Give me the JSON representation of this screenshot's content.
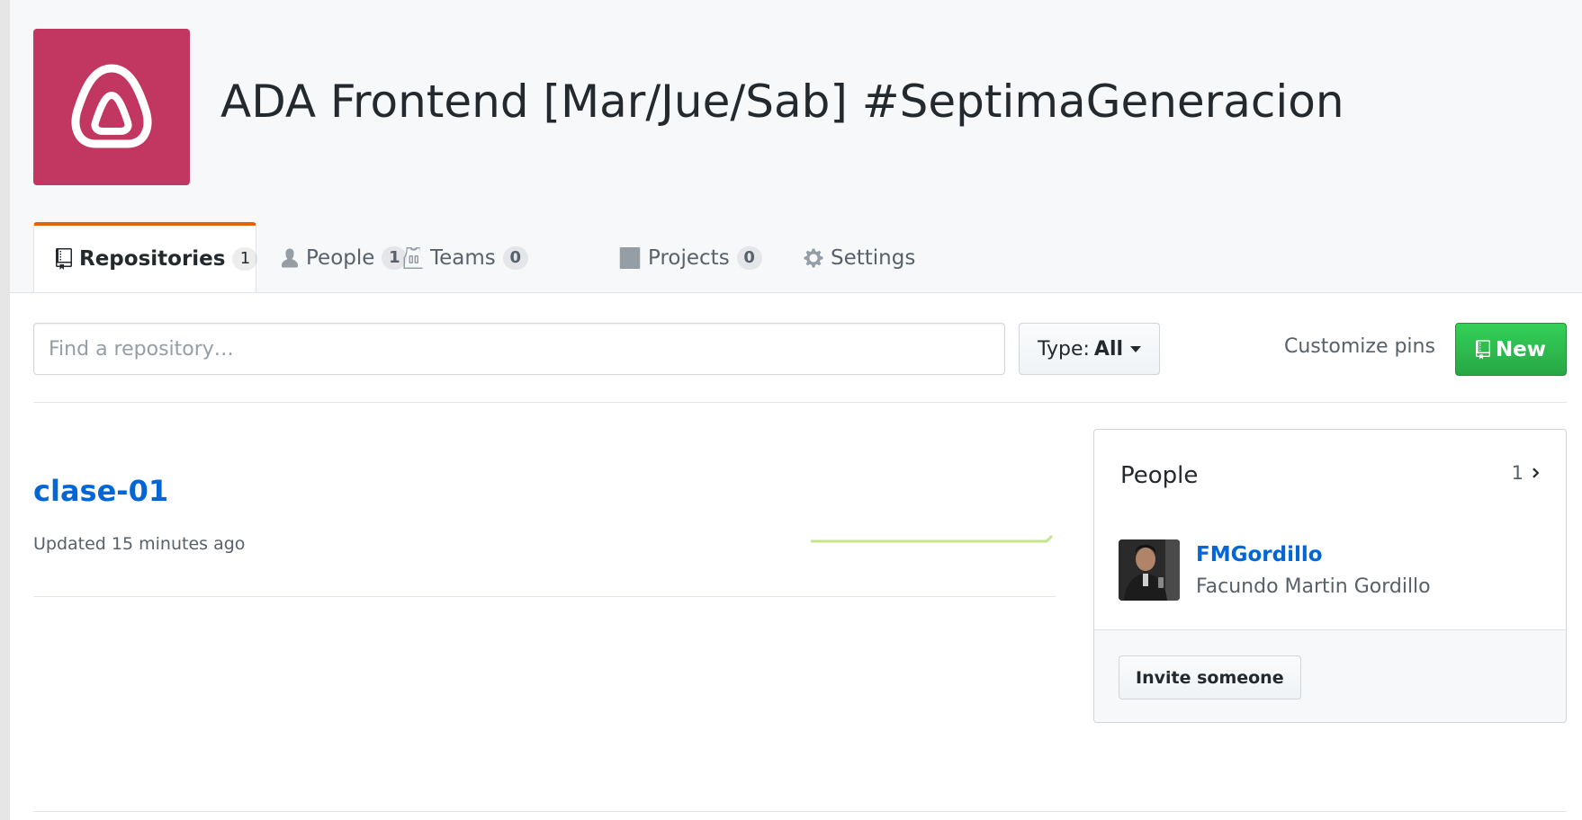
{
  "org": {
    "name": "ADA Frontend [Mar/Jue/Sab] #SeptimaGeneracion",
    "avatar_color": "#c23662"
  },
  "tabs": [
    {
      "label": "Repositories",
      "count": "1",
      "icon": "repo-icon",
      "selected": true
    },
    {
      "label": "People",
      "count": "1",
      "icon": "person-icon",
      "selected": false
    },
    {
      "label": "Teams",
      "count": "0",
      "icon": "jersey-icon",
      "selected": false
    },
    {
      "label": "Projects",
      "count": "0",
      "icon": "project-icon",
      "selected": false
    },
    {
      "label": "Settings",
      "icon": "gear-icon",
      "selected": false
    }
  ],
  "filter": {
    "search_placeholder": "Find a repository…",
    "type_label": "Type:",
    "type_value": "All",
    "customize_label": "Customize pins",
    "new_label": "New"
  },
  "repositories": [
    {
      "name": "clase-01",
      "updated": "Updated 15 minutes ago"
    }
  ],
  "people_box": {
    "title": "People",
    "count": "1",
    "members": [
      {
        "login": "FMGordillo",
        "name": "Facundo Martin Gordillo"
      }
    ],
    "invite_label": "Invite someone"
  },
  "colors": {
    "accent_tab": "#e36209",
    "link": "#0366d6",
    "new_button": "#2cbe4e",
    "sparkline": "#c6e48b"
  }
}
